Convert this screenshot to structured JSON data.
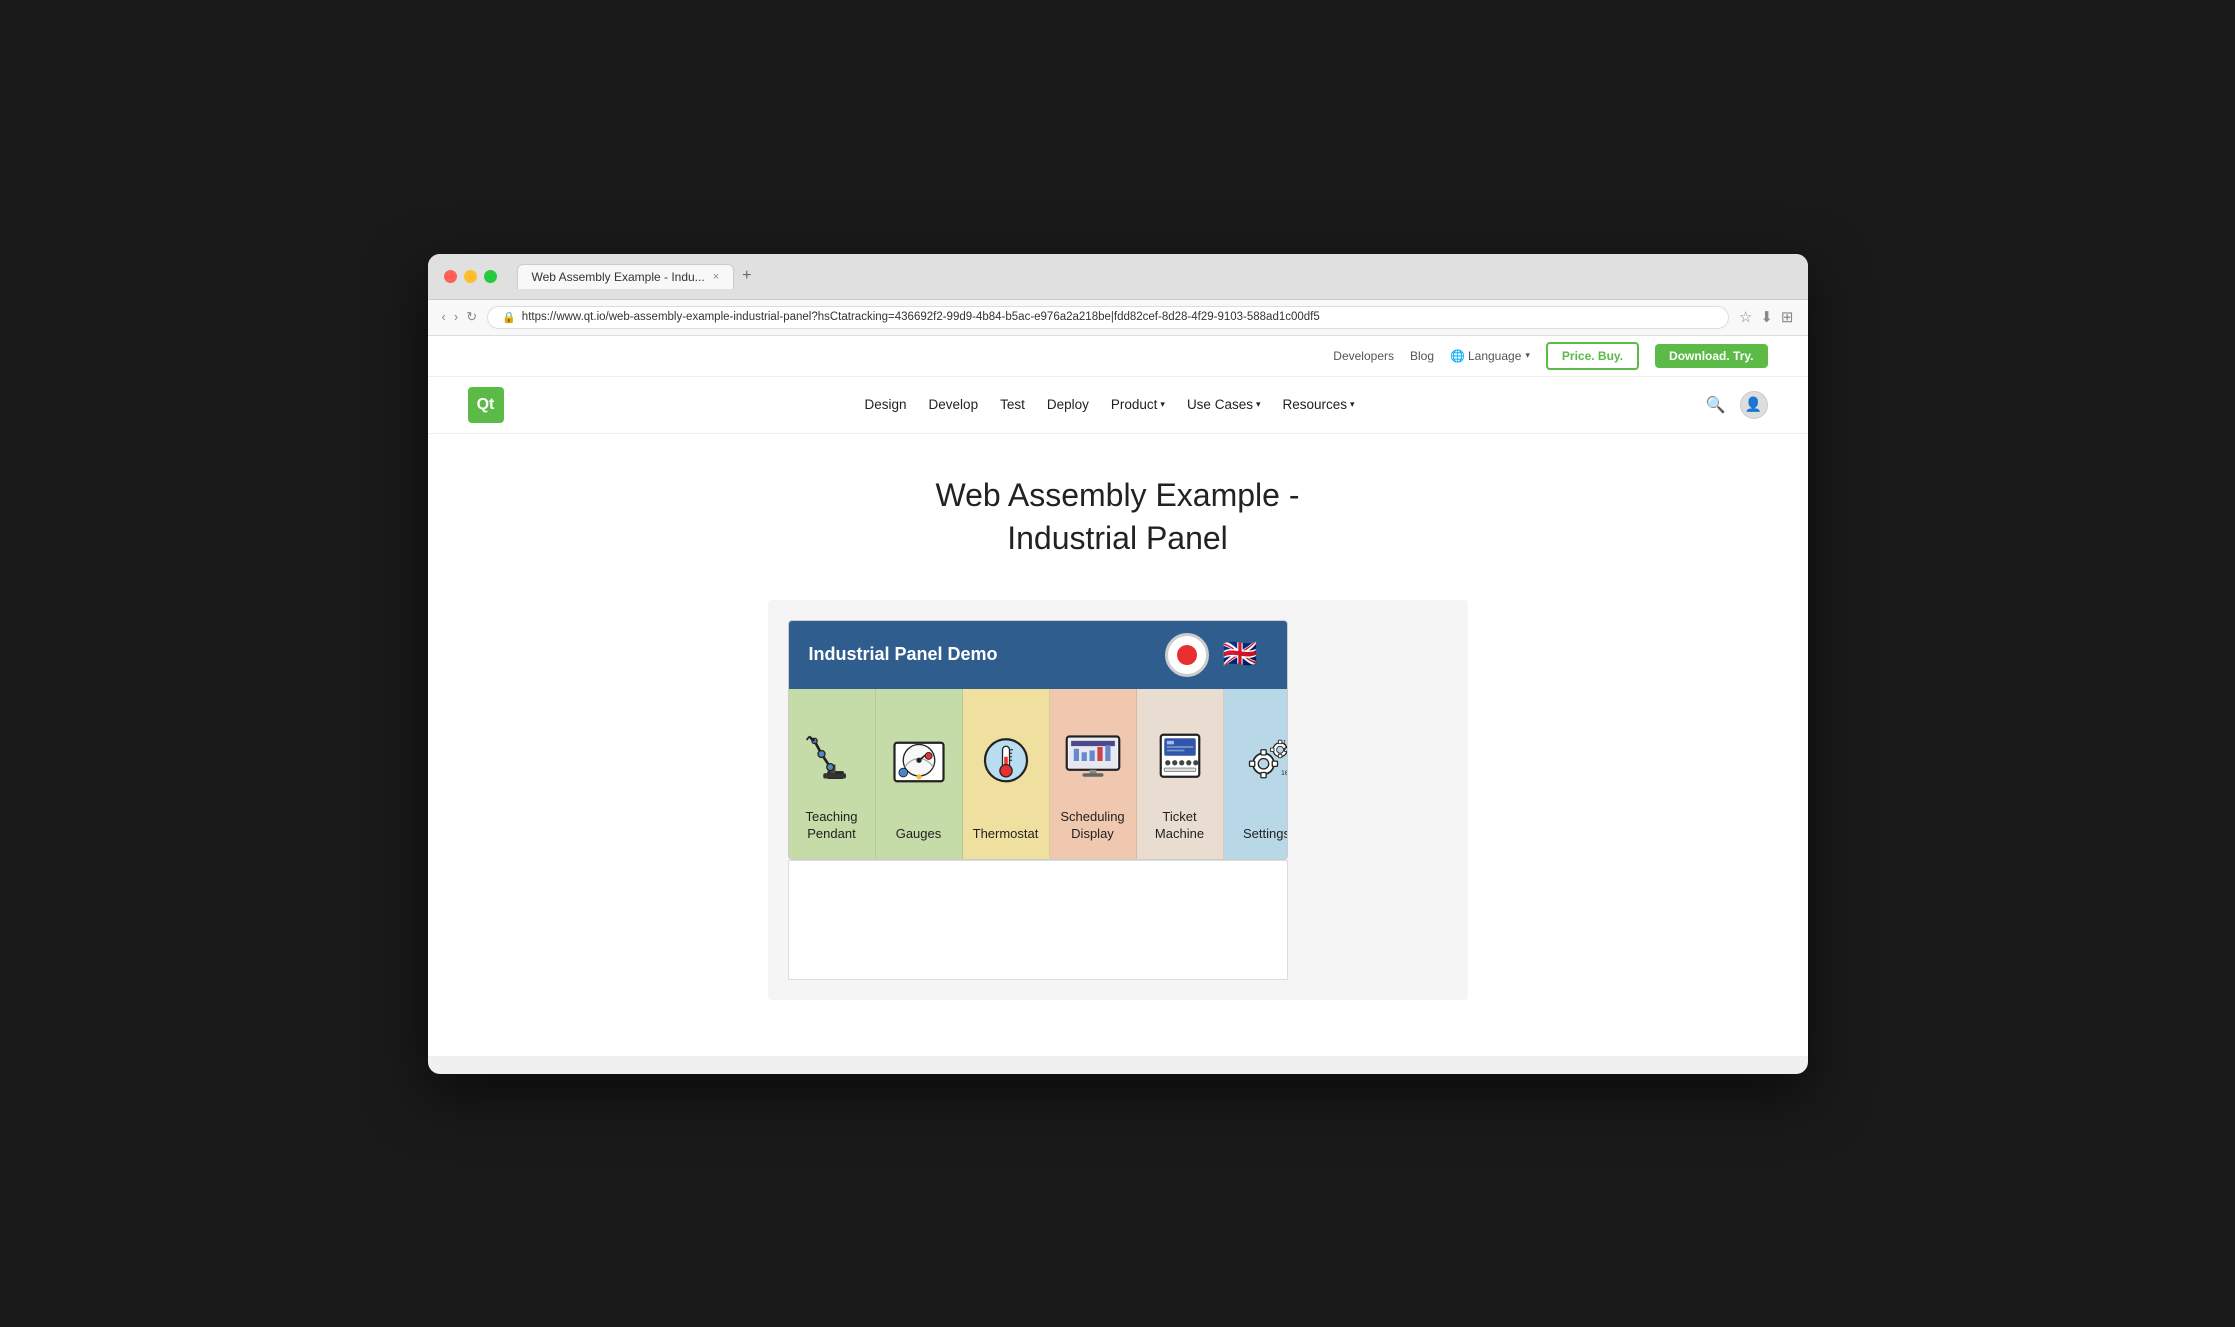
{
  "browser": {
    "tab_title": "Web Assembly Example - Indu...",
    "tab_close": "×",
    "tab_new": "+",
    "url": "https://www.qt.io/web-assembly-example-industrial-panel?hsCtatracking=436692f2-99d9-4b84-b5ac-e976a2a218be|fdd82cef-8d28-4f29-9103-588ad1c00df5",
    "nav_back": "‹",
    "nav_forward": "›",
    "nav_reload": "↻"
  },
  "topbar": {
    "developers": "Developers",
    "blog": "Blog",
    "language": "Language",
    "price_buy": "Price. Buy.",
    "download_try": "Download. Try."
  },
  "navbar": {
    "logo": "Qt",
    "links": [
      {
        "label": "Design",
        "has_dropdown": false
      },
      {
        "label": "Develop",
        "has_dropdown": false
      },
      {
        "label": "Test",
        "has_dropdown": false
      },
      {
        "label": "Deploy",
        "has_dropdown": false
      },
      {
        "label": "Product",
        "has_dropdown": true
      },
      {
        "label": "Use Cases",
        "has_dropdown": true
      },
      {
        "label": "Resources",
        "has_dropdown": true
      }
    ]
  },
  "page": {
    "title_line1": "Web Assembly Example -",
    "title_line2": "Industrial Panel"
  },
  "panel": {
    "header_title": "Industrial Panel Demo",
    "cells": [
      {
        "label": "Teaching\nPendant",
        "color": "green"
      },
      {
        "label": "Gauges",
        "color": "green"
      },
      {
        "label": "Thermostat",
        "color": "yellow"
      },
      {
        "label": "Scheduling\nDisplay",
        "color": "pink"
      },
      {
        "label": "Ticket\nMachine",
        "color": "cream"
      },
      {
        "label": "Settings",
        "color": "blue"
      }
    ]
  }
}
